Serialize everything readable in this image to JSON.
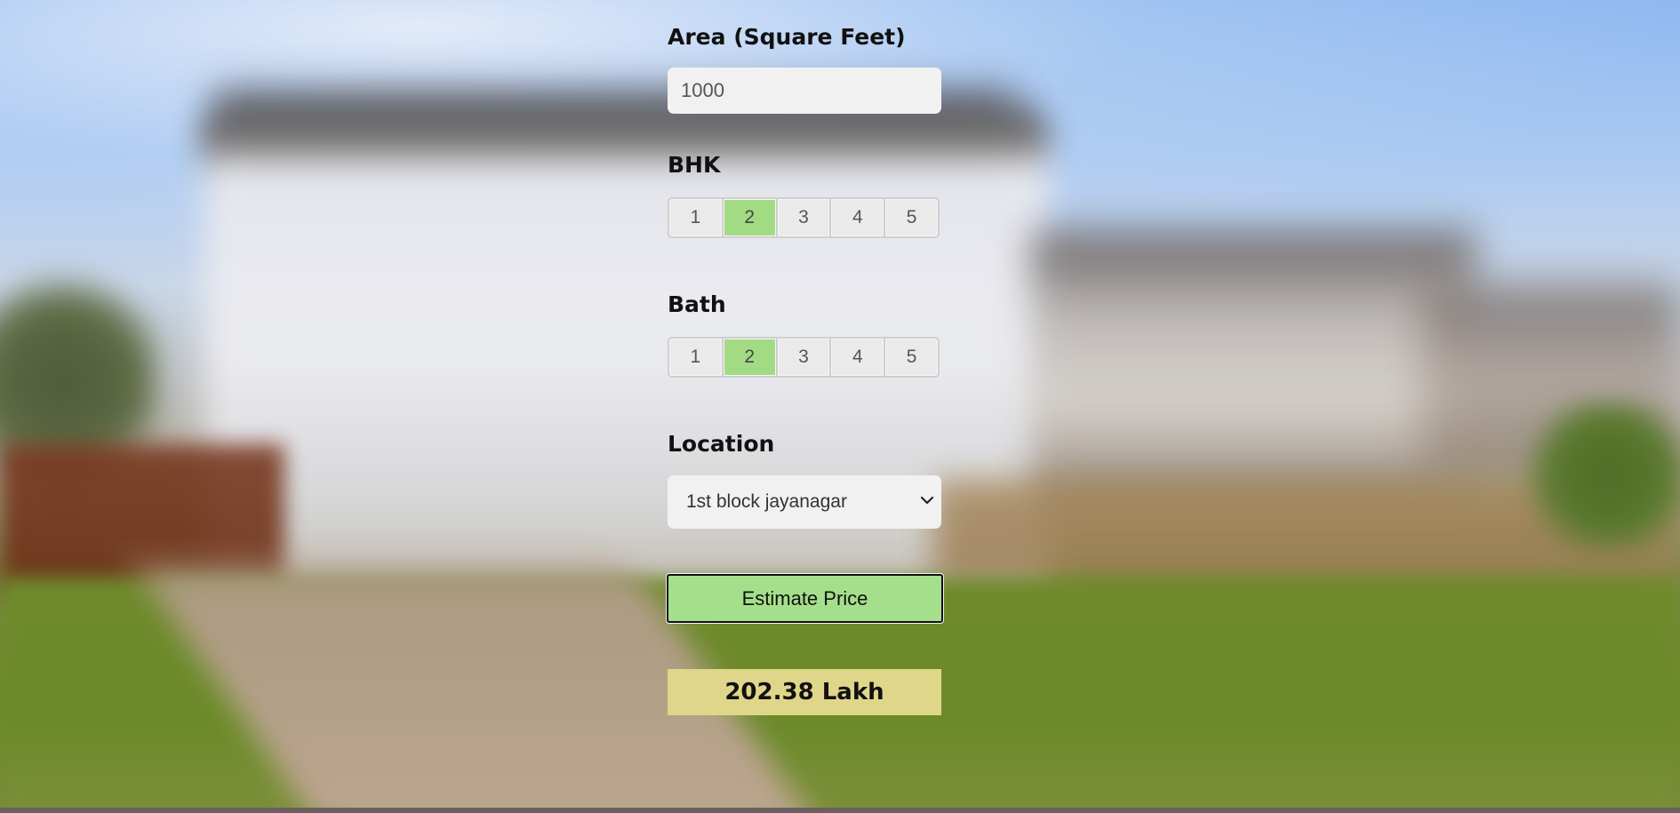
{
  "area": {
    "label": "Area (Square Feet)",
    "value": "1000"
  },
  "bhk": {
    "label": "BHK",
    "options": [
      "1",
      "2",
      "3",
      "4",
      "5"
    ],
    "selected": "2"
  },
  "bath": {
    "label": "Bath",
    "options": [
      "1",
      "2",
      "3",
      "4",
      "5"
    ],
    "selected": "2"
  },
  "location": {
    "label": "Location",
    "selected": "1st block jayanagar"
  },
  "estimate_button": {
    "label": "Estimate Price"
  },
  "result": {
    "text": "202.38 Lakh"
  },
  "colors": {
    "selected_option": "#a3db84",
    "button_fill": "#a5df8c",
    "result_fill": "#dfd68a",
    "field_fill": "#f1f1f1"
  },
  "icons": {
    "select_arrow": "chevron-down-icon"
  }
}
